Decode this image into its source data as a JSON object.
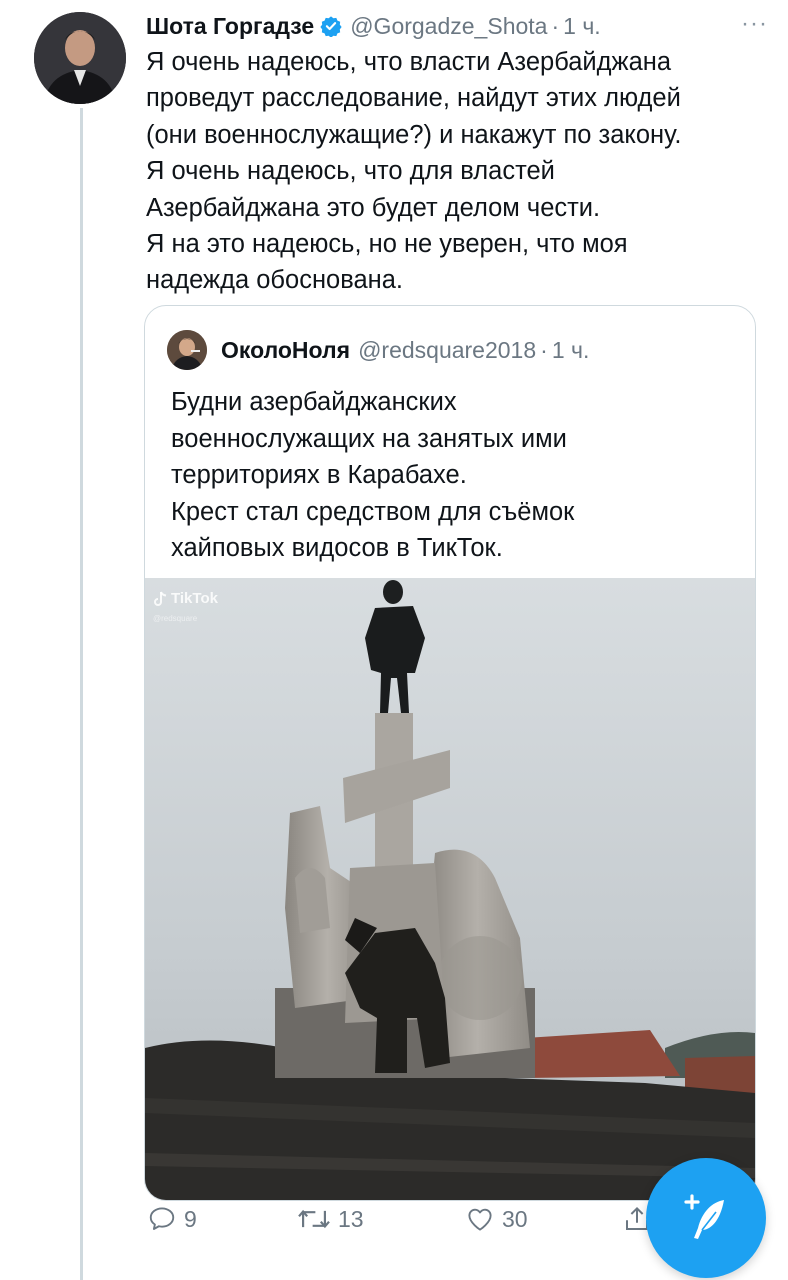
{
  "tweet": {
    "author_name": "Шота Горгадзе",
    "author_handle": "@Gorgadze_Shota",
    "separator": "·",
    "time": "1 ч.",
    "more_menu": "···",
    "lines": [
      "Я очень надеюсь, что власти Азербайджана",
      "проведут расследование, найдут этих людей",
      "(они военнослужащие?) и накажут по закону.",
      "Я очень надеюсь, что для властей",
      "Азербайджана это будет делом чести.",
      "Я на это надеюсь, но не уверен, что моя",
      "надежда обоснована."
    ]
  },
  "quoted_tweet": {
    "author_name": "ОколоНоля",
    "author_handle": "@redsquare2018",
    "separator": "·",
    "time": "1 ч.",
    "lines": [
      "Будни азербайджанских",
      "военнослужащих на занятых ими",
      "территориях в Карабахе.",
      "Крест стал средством для съёмок",
      "хайповых видосов в ТикТок."
    ],
    "media": {
      "watermark": "TikTok",
      "watermark_sub": "@redsquare"
    }
  },
  "actions": {
    "reply_count": "9",
    "retweet_count": "13",
    "like_count": "30"
  },
  "icons": {
    "verified": "verified-badge-icon",
    "reply": "reply-icon",
    "retweet": "retweet-icon",
    "like": "heart-icon",
    "share": "share-icon",
    "compose": "compose-tweet-icon"
  },
  "colors": {
    "accent": "#1da1f2",
    "muted_text": "#6b7782",
    "border": "#cfd9de"
  }
}
